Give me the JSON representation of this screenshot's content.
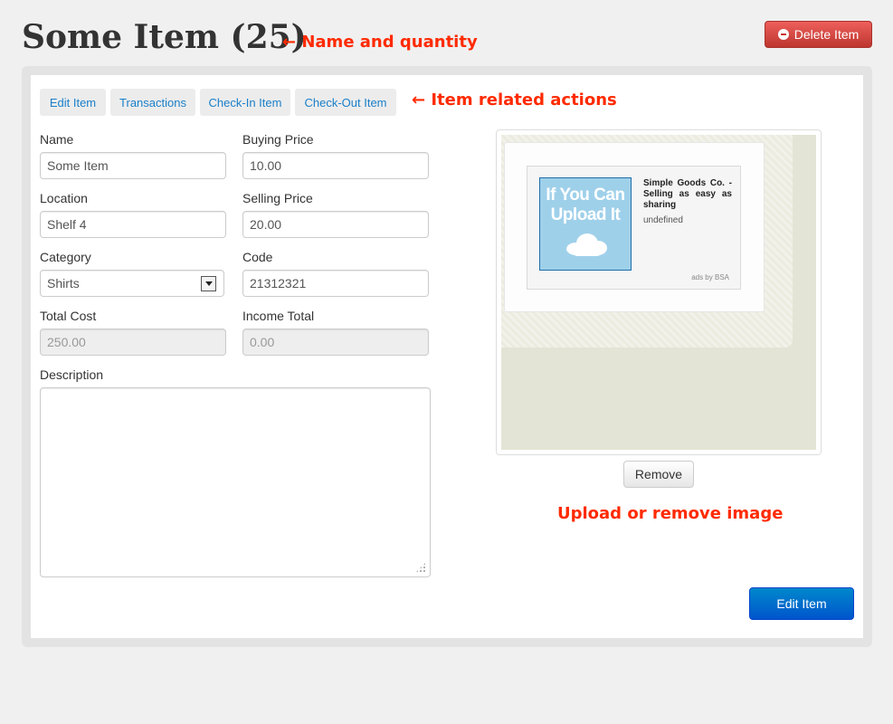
{
  "header": {
    "title": "Some Item (25)",
    "delete_label": "Delete Item"
  },
  "annotations": {
    "name_quantity": "← Name and quantity",
    "item_actions": "← Item related actions",
    "upload_remove": "Upload or remove image"
  },
  "tabs": [
    {
      "label": "Edit Item"
    },
    {
      "label": "Transactions"
    },
    {
      "label": "Check-In Item"
    },
    {
      "label": "Check-Out Item"
    }
  ],
  "form": {
    "name": {
      "label": "Name",
      "value": "Some Item"
    },
    "buying_price": {
      "label": "Buying Price",
      "value": "10.00"
    },
    "location": {
      "label": "Location",
      "value": "Shelf 4"
    },
    "selling_price": {
      "label": "Selling Price",
      "value": "20.00"
    },
    "category": {
      "label": "Category",
      "value": "Shirts"
    },
    "code": {
      "label": "Code",
      "value": "21312321"
    },
    "total_cost": {
      "label": "Total Cost",
      "value": "250.00"
    },
    "income_total": {
      "label": "Income Total",
      "value": "0.00"
    },
    "description": {
      "label": "Description",
      "value": ""
    }
  },
  "image": {
    "ad_image_text": "If You Can Upload It",
    "ad_title": "Simple Goods Co. - Selling as easy as sharing",
    "ad_subtitle": "undefined",
    "ad_by": "ads by BSA",
    "remove_label": "Remove"
  },
  "actions": {
    "edit_label": "Edit Item"
  },
  "colors": {
    "annotation": "#ff2a00",
    "danger": "#da4f49",
    "primary": "#0074cc",
    "link": "#1a7fc9"
  }
}
